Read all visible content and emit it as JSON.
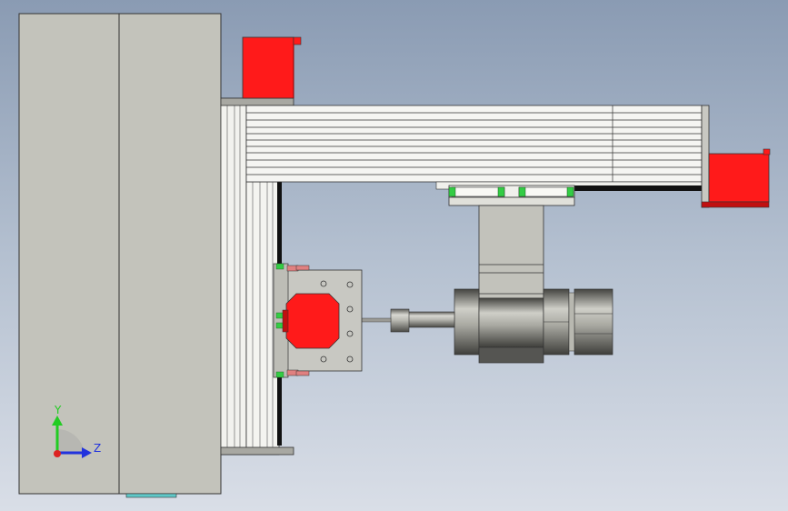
{
  "viewport": {
    "colors": {
      "background_top": "#8a9bb3",
      "background_bottom": "#d9dee7",
      "panel": "#c3c3bb",
      "part_red": "#ff1a1a",
      "bearing_green": "#33cc44"
    }
  },
  "triad": {
    "y_label": "Y",
    "z_label": "Z",
    "colors": {
      "y": "#22cc22",
      "z": "#2233dd",
      "origin": "#dd2222"
    }
  }
}
